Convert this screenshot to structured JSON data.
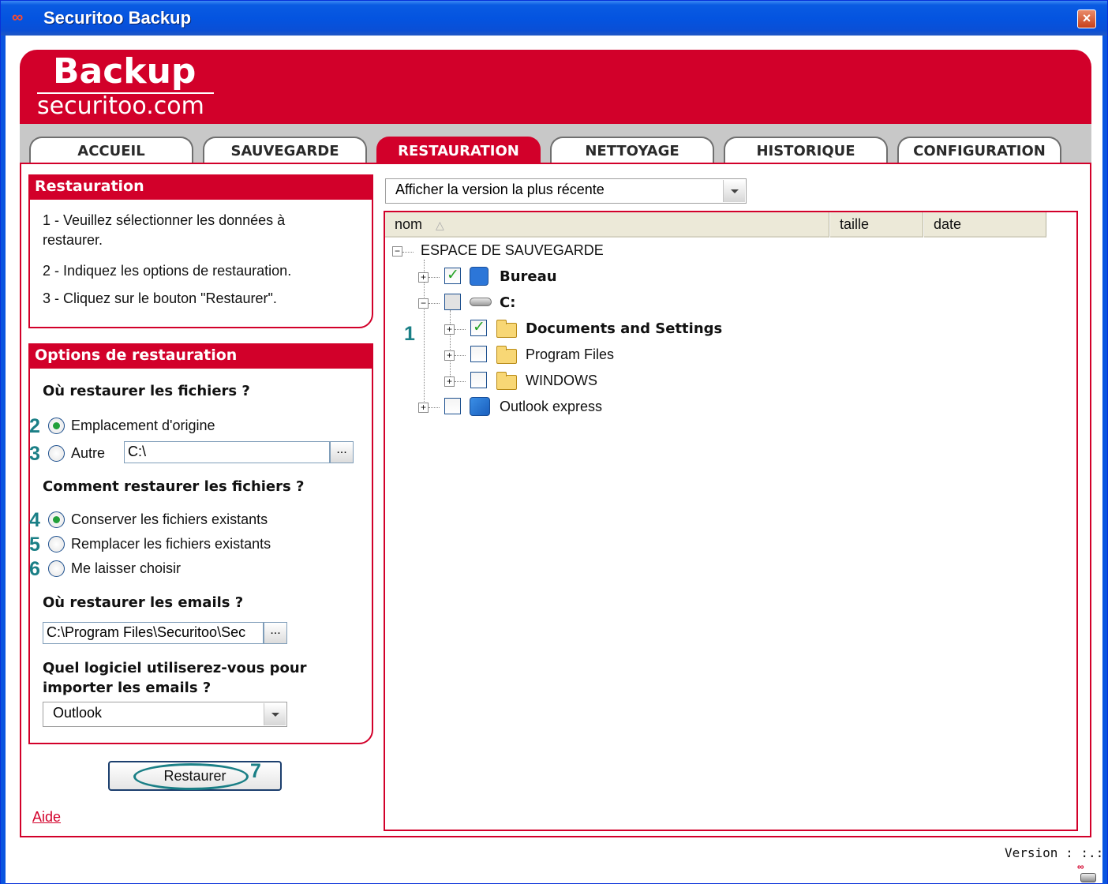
{
  "window": {
    "title": "Securitoo Backup",
    "close_label": "×",
    "logo_glyph": "∞"
  },
  "banner": {
    "title": "Backup",
    "subtitle": "securitoo.com"
  },
  "tabs": [
    {
      "label": "ACCUEIL",
      "active": false
    },
    {
      "label": "SAUVEGARDE",
      "active": false
    },
    {
      "label": "RESTAURATION",
      "active": true
    },
    {
      "label": "NETTOYAGE",
      "active": false
    },
    {
      "label": "HISTORIQUE",
      "active": false
    },
    {
      "label": "CONFIGURATION",
      "active": false
    }
  ],
  "restauration": {
    "title": "Restauration",
    "steps": [
      "1 - Veuillez sélectionner les données à",
      "restaurer.",
      "2 - Indiquez les options de restauration.",
      "3 - Cliquez sur le bouton \"Restaurer\"."
    ]
  },
  "options": {
    "title": "Options de restauration",
    "where_files_q": "Où restaurer les fichiers ?",
    "radio_origin": "Emplacement d'origine",
    "radio_other": "Autre",
    "other_path": "C:\\",
    "how_files_q": "Comment restaurer les fichiers ?",
    "radio_keep": "Conserver les fichiers existants",
    "radio_replace": "Remplacer les fichiers existants",
    "radio_choose": "Me laisser choisir",
    "where_emails_q": "Où restaurer les emails ?",
    "emails_path": "C:\\Program Files\\Securitoo\\Sec",
    "software_q_line1": "Quel logiciel utiliserez-vous pour",
    "software_q_line2": "importer les emails ?",
    "software_selected": "Outlook",
    "browse_label": "..."
  },
  "annotations": {
    "n1": "1",
    "n2": "2",
    "n3": "3",
    "n4": "4",
    "n5": "5",
    "n6": "6",
    "n7": "7"
  },
  "restore_button": "Restaurer",
  "help_link": "Aide",
  "version_select": "Afficher la version la plus récente",
  "tree": {
    "columns": {
      "name": "nom",
      "sort_icon": "△",
      "size": "taille",
      "date": "date"
    },
    "root": "ESPACE DE SAUVEGARDE",
    "items": {
      "bureau": "Bureau",
      "c": "C:",
      "documents": "Documents and Settings",
      "program_files": "Program Files",
      "windows": "WINDOWS",
      "outlook": "Outlook express"
    }
  },
  "version": "Version : :.:",
  "colors": {
    "brand_red": "#d2002a",
    "title_blue": "#0454e0",
    "annotation_teal": "#1a7f86",
    "check_green": "#21a121"
  }
}
